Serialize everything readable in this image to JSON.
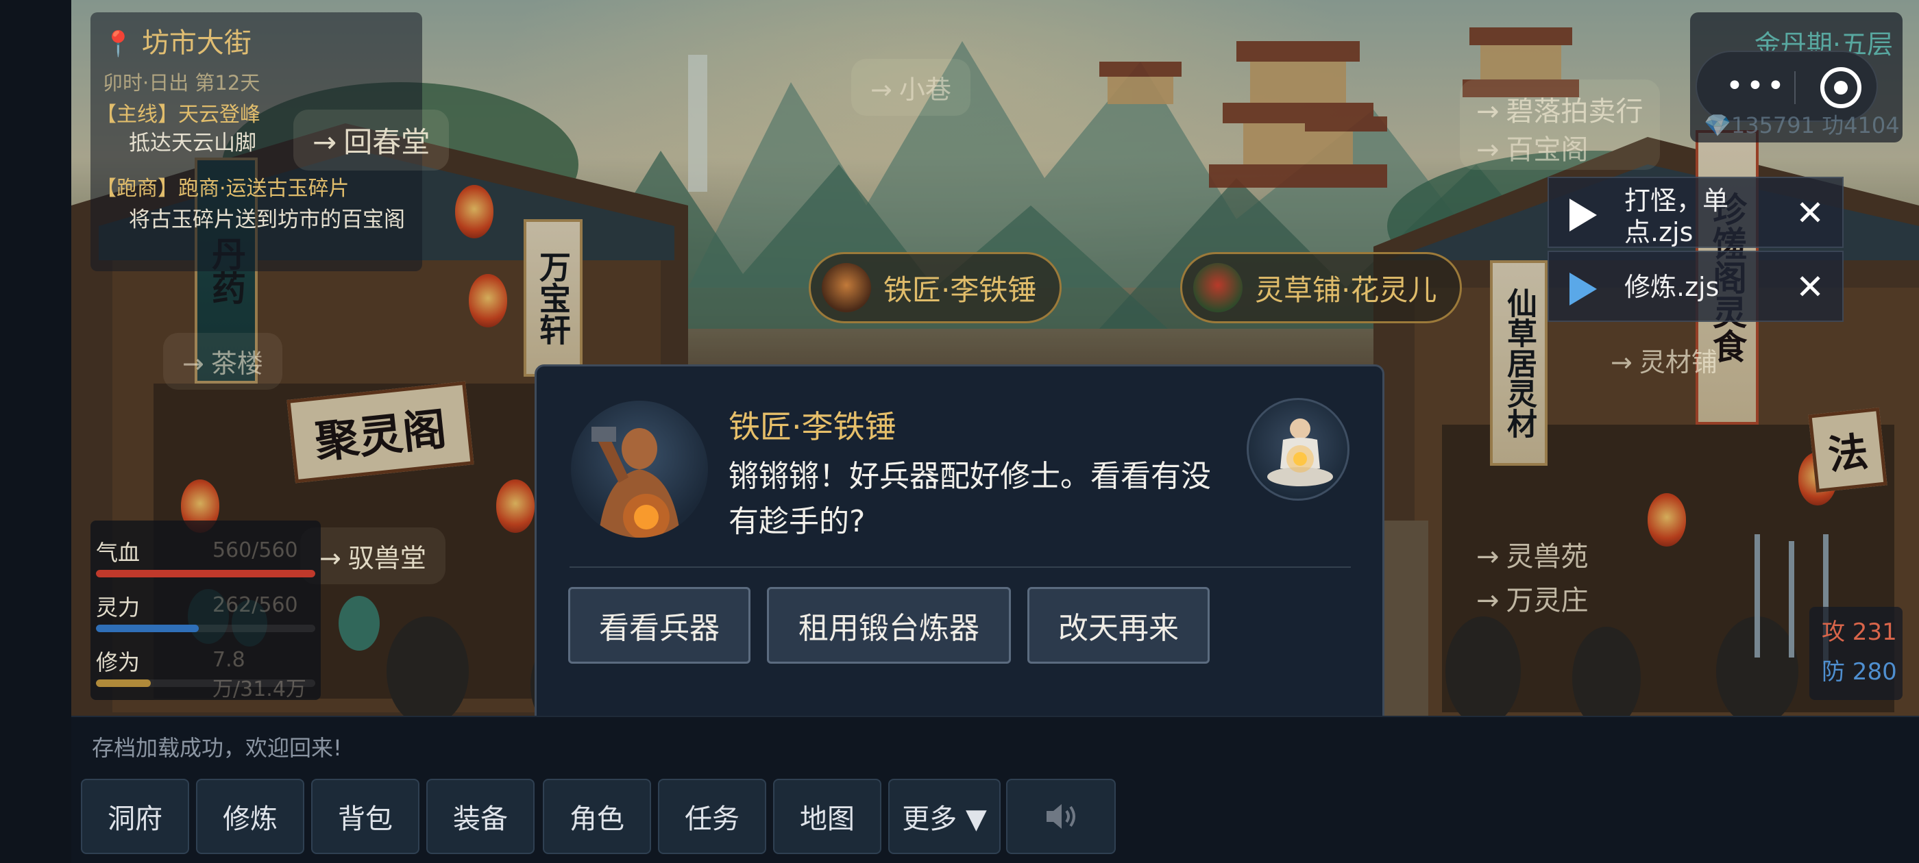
{
  "location": {
    "name": "坊市大街",
    "time": "卯时·日出  第12天"
  },
  "quests": [
    {
      "tag": "【主线】天云登峰",
      "desc": "抵达天云山脚"
    },
    {
      "tag": "【跑商】跑商·运送古玉碎片",
      "desc": "将古玉碎片送到坊市的百宝阁"
    }
  ],
  "nav_links": {
    "xiaoxiang": "小巷",
    "huichuntang": "回春堂",
    "chalou": "茶楼",
    "yushoutang": "驭兽堂",
    "biluo": "碧落拍卖行",
    "baibaoge": "百宝阁",
    "lingcaipu": "灵材铺",
    "lingshouyuan": "灵兽苑",
    "wanlingzhuang": "万灵庄",
    "arrow": "→"
  },
  "npcs": [
    {
      "label": "铁匠·李铁锤"
    },
    {
      "label": "灵草铺·花灵儿"
    }
  ],
  "realm": "金丹期·五层",
  "currency": "💎135791 功4104",
  "stats": [
    {
      "name": "气血",
      "value": "560/560",
      "fill": 1.0,
      "color": "#c0392b"
    },
    {
      "name": "灵力",
      "value": "262/560",
      "fill": 0.47,
      "color": "#2f6fb8"
    },
    {
      "name": "修为",
      "value": "7.8万/31.4万",
      "fill": 0.25,
      "color": "#b08a3a"
    }
  ],
  "combat": {
    "atk": "攻 231",
    "def": "防 280",
    "atk_color": "#d9654a",
    "def_color": "#4f8fd0"
  },
  "scripts": [
    {
      "name": "打怪，单点.zjs"
    },
    {
      "name": "修炼.zjs"
    }
  ],
  "dialog": {
    "npc_name": "铁匠·李铁锤",
    "line": "锵锵锵！好兵器配好修士。看看有没有趁手的?",
    "choices": [
      "看看兵器",
      "租用锻台炼器",
      "改天再来"
    ]
  },
  "status_message": "存档加载成功，欢迎回来!",
  "menu": [
    "洞府",
    "修炼",
    "背包",
    "装备",
    "角色",
    "任务",
    "地图",
    "更多 ▼"
  ],
  "shop_signs": {
    "left_red": "丹药",
    "juling": "聚灵阁",
    "wanbao": "万宝轩",
    "xiancao": "仙草居灵材",
    "zhenxiu": "珍馐阁灵食",
    "fa": "法"
  },
  "icons": {
    "pin": "location-pin-icon",
    "close": "close-icon",
    "play": "play-icon",
    "more": "more-dots-icon",
    "target": "target-icon",
    "sound": "speaker-icon"
  }
}
